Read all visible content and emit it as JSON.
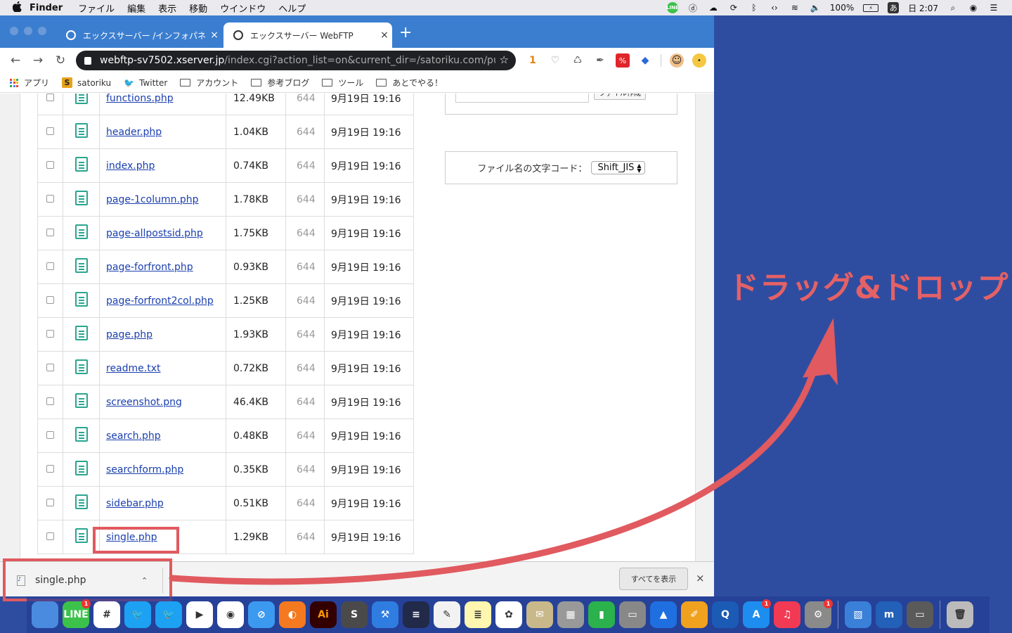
{
  "menubar": {
    "apple": "",
    "app": "Finder",
    "menus": [
      "ファイル",
      "編集",
      "表示",
      "移動",
      "ウインドウ",
      "ヘルプ"
    ],
    "battery": "100%",
    "ime": "あ",
    "clock": "日 2:07"
  },
  "browser": {
    "tabs": [
      {
        "title": "エックスサーバー /インフォパネル",
        "close": "×"
      },
      {
        "title": "エックスサーバー WebFTP",
        "close": "×"
      }
    ],
    "newtab": "+",
    "url_host": "webftp-sv7502.xserver.jp",
    "url_path": "/index.cgi?action_list=on&current_dir=/satoriku.com/pu...",
    "ext_badge": "1",
    "bookmarks": [
      {
        "label": "アプリ",
        "icon": "apps-grid-icon"
      },
      {
        "label": "satoriku",
        "icon": "s-icon"
      },
      {
        "label": "Twitter",
        "icon": "twitter-icon"
      },
      {
        "label": "アカウント",
        "icon": "folder-icon"
      },
      {
        "label": "参考ブログ",
        "icon": "folder-icon"
      },
      {
        "label": "ツール",
        "icon": "folder-icon"
      },
      {
        "label": "あとでやる！",
        "icon": "folder-icon"
      }
    ]
  },
  "files": [
    {
      "name": "functions.php",
      "size": "12.49KB",
      "perm": "644",
      "date": "9月19日 19:16"
    },
    {
      "name": "header.php",
      "size": "1.04KB",
      "perm": "644",
      "date": "9月19日 19:16"
    },
    {
      "name": "index.php",
      "size": "0.74KB",
      "perm": "644",
      "date": "9月19日 19:16"
    },
    {
      "name": "page-1column.php",
      "size": "1.78KB",
      "perm": "644",
      "date": "9月19日 19:16"
    },
    {
      "name": "page-allpostsid.php",
      "size": "1.75KB",
      "perm": "644",
      "date": "9月19日 19:16"
    },
    {
      "name": "page-forfront.php",
      "size": "0.93KB",
      "perm": "644",
      "date": "9月19日 19:16"
    },
    {
      "name": "page-forfront2col.php",
      "size": "1.25KB",
      "perm": "644",
      "date": "9月19日 19:16"
    },
    {
      "name": "page.php",
      "size": "1.93KB",
      "perm": "644",
      "date": "9月19日 19:16"
    },
    {
      "name": "readme.txt",
      "size": "0.72KB",
      "perm": "644",
      "date": "9月19日 19:16"
    },
    {
      "name": "screenshot.png",
      "size": "46.4KB",
      "perm": "644",
      "date": "9月19日 19:16"
    },
    {
      "name": "search.php",
      "size": "0.48KB",
      "perm": "644",
      "date": "9月19日 19:16"
    },
    {
      "name": "searchform.php",
      "size": "0.35KB",
      "perm": "644",
      "date": "9月19日 19:16"
    },
    {
      "name": "sidebar.php",
      "size": "0.51KB",
      "perm": "644",
      "date": "9月19日 19:16"
    },
    {
      "name": "single.php",
      "size": "1.29KB",
      "perm": "644",
      "date": "9月19日 19:16"
    }
  ],
  "sidebar": {
    "create_button": "ファイル作成",
    "charset_label": "ファイル名の文字コード：",
    "charset_value": "Shift_JIS"
  },
  "download_shelf": {
    "file": "single.php",
    "chevron": "⌃",
    "show_all": "すべてを表示",
    "close": "×"
  },
  "annotation": {
    "text": "ドラッグ&ドロップ",
    "color": "#e05a5f"
  },
  "dock": {
    "apps": [
      {
        "name": "finder",
        "label": "",
        "color": "#4a8be0"
      },
      {
        "name": "line",
        "label": "LINE",
        "color": "#3cc24a",
        "badge": "1"
      },
      {
        "name": "slack",
        "label": "#",
        "color": "#ffffff"
      },
      {
        "name": "twitter-1",
        "label": "🐦",
        "color": "#1da1f2"
      },
      {
        "name": "twitter-2",
        "label": "🐦",
        "color": "#1da1f2"
      },
      {
        "name": "player",
        "label": "▶",
        "color": "#ffffff"
      },
      {
        "name": "chrome",
        "label": "◉",
        "color": "#ffffff"
      },
      {
        "name": "safari",
        "label": "⊘",
        "color": "#3b9af0"
      },
      {
        "name": "firefox",
        "label": "◐",
        "color": "#f4791f"
      },
      {
        "name": "illustrator",
        "label": "Ai",
        "color": "#330000"
      },
      {
        "name": "sublime",
        "label": "S",
        "color": "#4a4a4a"
      },
      {
        "name": "xcode",
        "label": "⚒",
        "color": "#2f7de1"
      },
      {
        "name": "disk-utility",
        "label": "≡",
        "color": "#222a4a"
      },
      {
        "name": "textedit",
        "label": "✎",
        "color": "#f2f2f2"
      },
      {
        "name": "notes",
        "label": "≣",
        "color": "#fff7b0"
      },
      {
        "name": "photos",
        "label": "✿",
        "color": "#ffffff"
      },
      {
        "name": "preview",
        "label": "✉",
        "color": "#c9b98a"
      },
      {
        "name": "calculator",
        "label": "▦",
        "color": "#999999"
      },
      {
        "name": "numbers",
        "label": "▮",
        "color": "#2bb24c"
      },
      {
        "name": "image-capture",
        "label": "▭",
        "color": "#888888"
      },
      {
        "name": "keynote",
        "label": "▲",
        "color": "#1f6fe0"
      },
      {
        "name": "pages",
        "label": "✐",
        "color": "#f0a21f"
      },
      {
        "name": "quicktime",
        "label": "Q",
        "color": "#1b5bb5"
      },
      {
        "name": "app-store",
        "label": "A",
        "color": "#1d8ef0",
        "badge": "1"
      },
      {
        "name": "music",
        "label": "♫",
        "color": "#f23a55"
      },
      {
        "name": "system-preferences",
        "label": "⚙",
        "color": "#8a8a8a",
        "badge": "1"
      },
      {
        "name": "migration",
        "label": "▧",
        "color": "#3a80d8"
      },
      {
        "name": "m-app",
        "label": "m",
        "color": "#2360b8"
      },
      {
        "name": "macbook",
        "label": "▭",
        "color": "#5a5a5a"
      },
      {
        "name": "trash",
        "label": "🗑",
        "color": "#bbbbbb"
      }
    ]
  }
}
